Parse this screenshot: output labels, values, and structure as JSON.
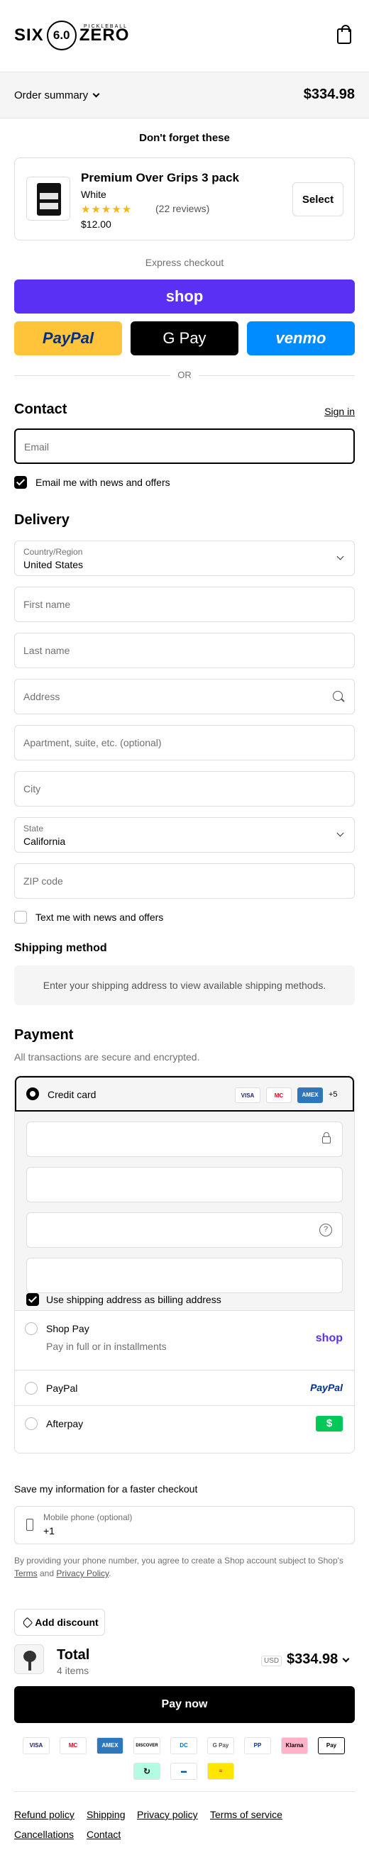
{
  "header": {
    "brand_left": "SIX",
    "brand_ring": "6.0",
    "brand_right": "ZERO",
    "brand_sub": "PICKLEBALL"
  },
  "summary": {
    "label": "Order summary",
    "total": "$334.98"
  },
  "upsell": {
    "title": "Don't forget these",
    "product": {
      "name": "Premium Over Grips 3 pack",
      "variant": "White",
      "stars": "★★★★★",
      "reviews": "(22 reviews)",
      "price": "$12.00",
      "button": "Select"
    }
  },
  "express": {
    "label": "Express checkout",
    "shop": "shop",
    "paypal": "PayPal",
    "gpay": "G Pay",
    "venmo": "venmo",
    "or": "OR"
  },
  "contact": {
    "title": "Contact",
    "signin": "Sign in",
    "email_placeholder": "Email",
    "news_label": "Email me with news and offers"
  },
  "delivery": {
    "title": "Delivery",
    "country_label": "Country/Region",
    "country_value": "United States",
    "first_name": "First name",
    "last_name": "Last name",
    "address": "Address",
    "apartment": "Apartment, suite, etc. (optional)",
    "city": "City",
    "state_label": "State",
    "state_value": "California",
    "zip": "ZIP code",
    "text_label": "Text me with news and offers"
  },
  "shipping": {
    "title": "Shipping method",
    "message": "Enter your shipping address to view available shipping methods."
  },
  "payment": {
    "title": "Payment",
    "subtitle": "All transactions are secure and encrypted.",
    "credit_card": "Credit card",
    "card_badges": [
      "VISA",
      "MC",
      "AMEX",
      "+5"
    ],
    "billing_label": "Use shipping address as billing address",
    "shop_pay": "Shop Pay",
    "shop_pay_sub": "Pay in full or in installments",
    "shop_pay_logo": "shop",
    "paypal": "PayPal",
    "paypal_logo": "PayPal",
    "afterpay": "Afterpay",
    "afterpay_logo": "$"
  },
  "save": {
    "title": "Save my information for a faster checkout",
    "phone_label": "Mobile phone (optional)",
    "phone_value": "+1",
    "legal_pre": "By providing your phone number, you agree to create a Shop account subject to Shop's ",
    "terms": "Terms",
    "and": " and ",
    "privacy": "Privacy Policy",
    "legal_end": "."
  },
  "discount": {
    "label": "Add discount"
  },
  "total": {
    "label": "Total",
    "items": "4 items",
    "currency": "USD",
    "amount": "$334.98"
  },
  "pay_now": "Pay now",
  "payment_methods": [
    "VISA",
    "MC",
    "AMEX",
    "DISCOVER",
    "DC",
    "G Pay",
    "PP",
    "Klarna",
    " Pay",
    "↻",
    "▬",
    "≡"
  ],
  "footer": {
    "links": [
      "Refund policy",
      "Shipping",
      "Privacy policy",
      "Terms of service",
      "Cancellations",
      "Contact"
    ]
  }
}
